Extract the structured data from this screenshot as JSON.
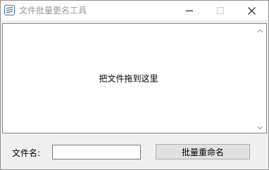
{
  "window": {
    "title": "文件批量更名工具",
    "accent_color": "#4a7a9a"
  },
  "titlebar_buttons": {
    "minimize_icon": "minimize-icon",
    "maximize_icon": "maximize-icon",
    "close_icon": "close-icon",
    "maximize_enabled": false
  },
  "dropzone": {
    "label": "把文件拖到这里",
    "scroll_up_icon": "chevron-up-icon",
    "scroll_down_icon": "chevron-down-icon"
  },
  "form": {
    "filename_label": "文件名:",
    "filename_value": "",
    "rename_button_label": "批量重命名"
  }
}
